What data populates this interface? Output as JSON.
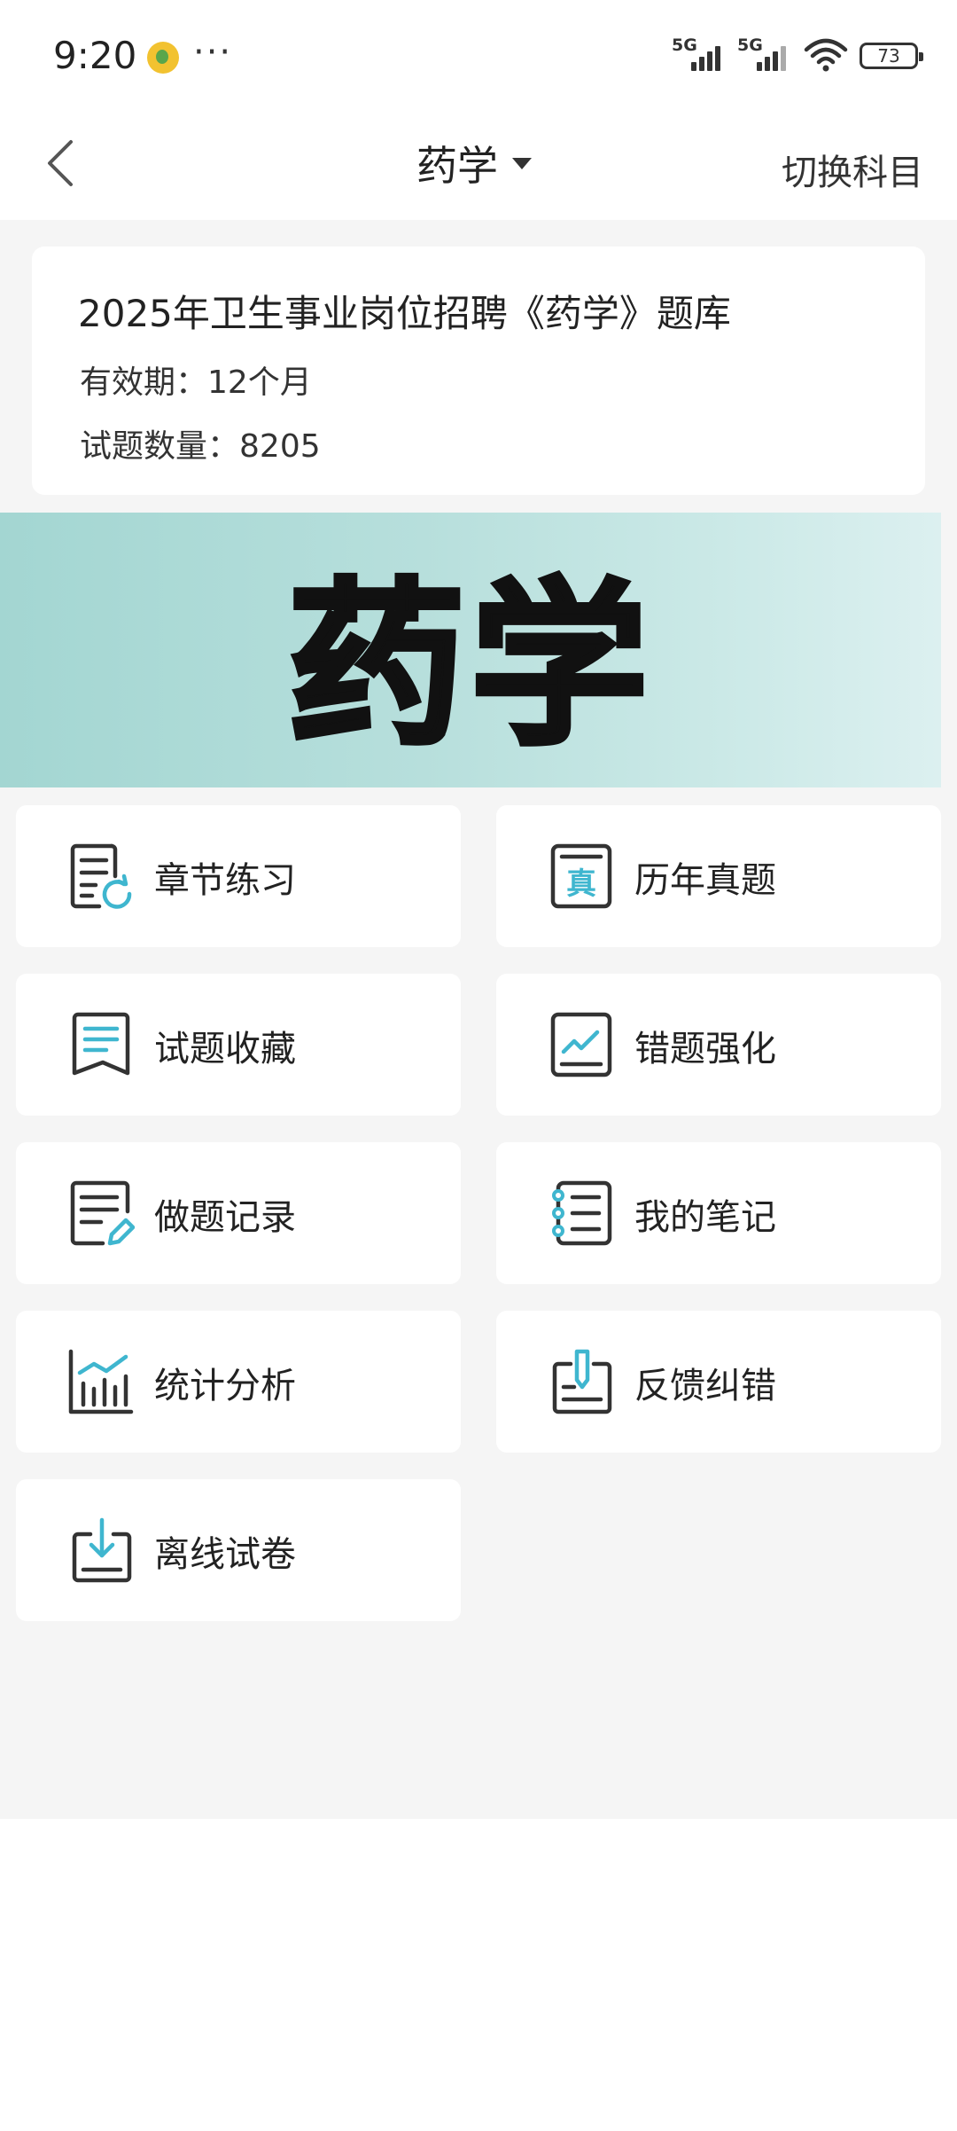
{
  "status_bar": {
    "time": "9:20",
    "more": "···",
    "signal1_label": "5G",
    "signal2_label": "5G",
    "battery": "73"
  },
  "nav": {
    "title": "药学",
    "switch_label": "切换科目"
  },
  "info": {
    "title": "2025年卫生事业岗位招聘《药学》题库",
    "validity_label": "有效期：",
    "validity_value": "12个月",
    "count_label": "试题数量：",
    "count_value": "8205"
  },
  "banner": {
    "text": "药学"
  },
  "menu": [
    {
      "label": "章节练习",
      "icon": "chapter-practice-icon"
    },
    {
      "label": "历年真题",
      "icon": "past-exams-icon"
    },
    {
      "label": "试题收藏",
      "icon": "bookmark-icon"
    },
    {
      "label": "错题强化",
      "icon": "mistake-chart-icon"
    },
    {
      "label": "做题记录",
      "icon": "record-edit-icon"
    },
    {
      "label": "我的笔记",
      "icon": "notebook-icon"
    },
    {
      "label": "统计分析",
      "icon": "statistics-icon"
    },
    {
      "label": "反馈纠错",
      "icon": "feedback-icon"
    },
    {
      "label": "离线试卷",
      "icon": "download-icon"
    }
  ],
  "colors": {
    "accent": "#3fb6cf",
    "icon_stroke": "#333333",
    "page_bg": "#f5f5f5",
    "banner_start": "#a3d6d2",
    "banner_end": "#dcf0f0"
  }
}
